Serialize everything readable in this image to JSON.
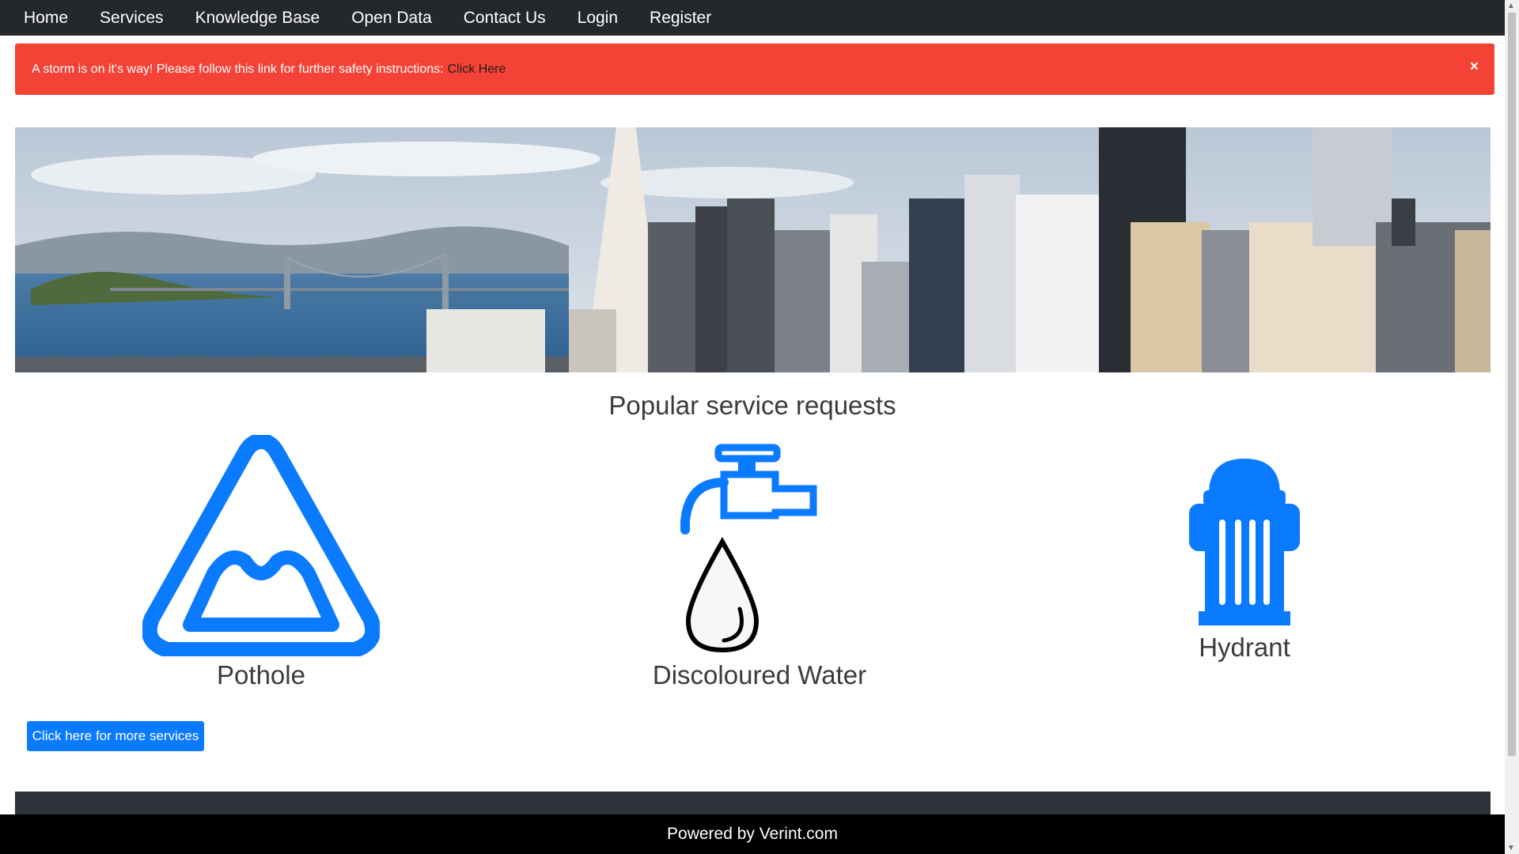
{
  "nav": {
    "items": [
      "Home",
      "Services",
      "Knowledge Base",
      "Open Data",
      "Contact Us",
      "Login",
      "Register"
    ]
  },
  "alert": {
    "message": "A storm is on it's way! Please follow this link for further safety instructions:",
    "link_text": "Click Here",
    "close_glyph": "×"
  },
  "banner": {
    "icon": "city-skyline-image"
  },
  "services": {
    "title": "Popular service requests",
    "items": [
      {
        "label": "Pothole",
        "icon": "pothole-icon"
      },
      {
        "label": "Discoloured Water",
        "icon": "water-tap-icon"
      },
      {
        "label": "Hydrant",
        "icon": "hydrant-icon"
      }
    ],
    "more_button": "Click here for more services"
  },
  "footer": {
    "text": "Powered by Verint.com"
  },
  "colors": {
    "nav_bg": "#24272b",
    "alert_bg": "#f44336",
    "accent": "#0a7aff",
    "footer_bg": "#000000"
  }
}
